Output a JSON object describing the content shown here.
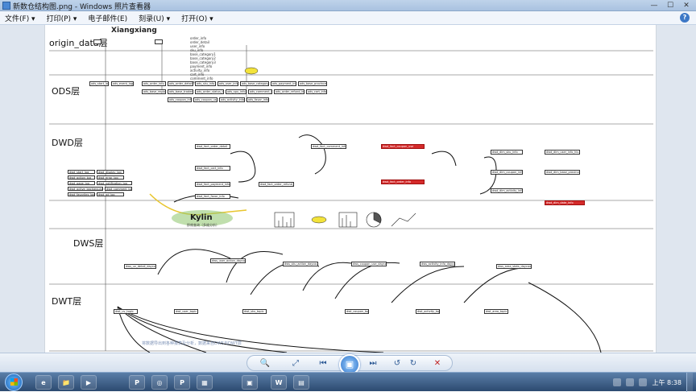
{
  "window": {
    "title": "新数仓结构图.png - Windows 照片查看器",
    "controls": [
      "—",
      "☐",
      "✕"
    ]
  },
  "menu": {
    "items": [
      "文件(F) ▾",
      "打印(P) ▾",
      "电子邮件(E)",
      "刻录(U) ▾",
      "打开(O) ▾"
    ],
    "help": "?"
  },
  "diagram": {
    "author": "Xiangxiang",
    "layers": {
      "origin": "origin_data层",
      "ods": "ODS层",
      "dwd": "DWD层",
      "dws": "DWS层",
      "dwt": "DWT层"
    },
    "kylin": "Kylin",
    "kylin_sub": "即席查询（多维分析）",
    "origin_fields": [
      "order_info",
      "order_detail",
      "user_info",
      "sku_info",
      "base_category1",
      "base_category2",
      "base_category3",
      "payment_info",
      "activity_info",
      "cart_info",
      "comment_info",
      "refund_info"
    ],
    "ods_tables": [
      "ods_start_log",
      "ods_event_log",
      "ods_order_info",
      "ods_order_detail",
      "ods_sku_info",
      "ods_user_info",
      "ods_base_category1",
      "ods_payment_info",
      "ods_base_province",
      "ods_base_region",
      "ods_base_trademark",
      "ods_order_status_log",
      "ods_spu_info",
      "ods_comment_info",
      "ods_order_refund_info",
      "ods_cart_info",
      "ods_coupon_info",
      "ods_coupon_use",
      "ods_activity_info",
      "ods_favor_info"
    ],
    "dwd_log_tables": [
      "dwd_start_log",
      "dwd_display_log",
      "dwd_action_log",
      "dwd_error_log",
      "dwd_page_log",
      "dwd_notification_log",
      "dwd_active_background_log",
      "dwd_comment_log",
      "dwd_favorites_log",
      "dwd_ad_log"
    ],
    "dwd_fact_tables": [
      "dwd_fact_order_detail",
      "dwd_fact_cart_info",
      "dwd_fact_payment_info",
      "dwd_fact_order_refund_info",
      "dwd_fact_comment_info",
      "dwd_fact_favor_info"
    ],
    "dwd_red_tables": [
      "dwd_fact_coupon_use",
      "dwd_fact_order_info"
    ],
    "dwd_dim_tables": [
      "dwd_dim_sku_info",
      "dwd_dim_coupon_info",
      "dwd_dim_activity_info",
      "dwd_dim_user_info_his",
      "dwd_dim_base_province",
      "dwd_dim_date_info"
    ],
    "dws_tables": [
      "dws_uv_detail_daycount",
      "dws_user_action_daycount",
      "dws_sku_action_daycount",
      "dws_coupon_use_daycount",
      "dws_activity_info_daycount",
      "dws_area_stats_daycount"
    ],
    "dwt_tables": [
      "dwt_uv_topic",
      "dwt_user_topic",
      "dwt_sku_topic",
      "dwt_coupon_topic",
      "dwt_activity_topic",
      "dwt_area_topic"
    ],
    "footer_note": "将数据导出到各种报表及分析，数据来自DWS与DWT层"
  },
  "controlbar": {
    "zoom": "🔍▾",
    "fit": "⤢",
    "prev": "⏮",
    "slideshow": "▣",
    "next": "⏭",
    "rotate_left": "↺",
    "rotate_right": "↻",
    "delete": "✕"
  },
  "taskbar": {
    "apps": [
      "e",
      "📁",
      "▶",
      "P",
      "◎",
      "P",
      "▦",
      "▣",
      "W",
      "▤"
    ],
    "clock": "上午 8:38"
  },
  "colors": {
    "accent": "#2f74c9",
    "red_box": "#d42a2a",
    "link_blue": "#2a55b0",
    "highlight_yellow": "#f3e33a",
    "kylin_green": "#7cb35a"
  }
}
